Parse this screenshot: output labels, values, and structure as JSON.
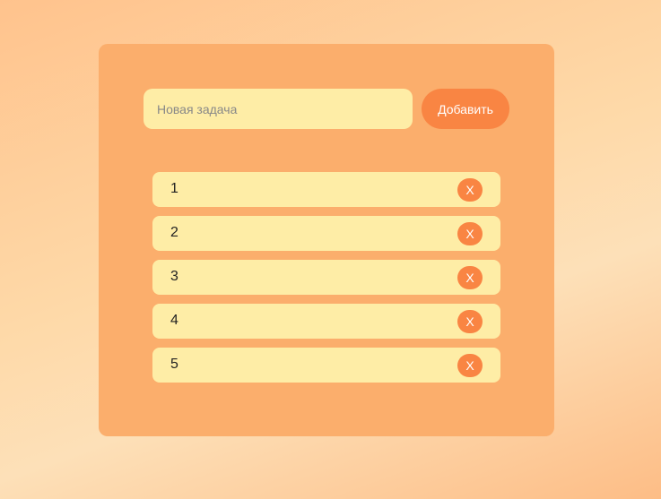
{
  "form": {
    "input_value": "",
    "input_placeholder": "Новая задача",
    "add_label": "Добавить"
  },
  "tasks": [
    {
      "text": "1",
      "delete_label": "X"
    },
    {
      "text": "2",
      "delete_label": "X"
    },
    {
      "text": "3",
      "delete_label": "X"
    },
    {
      "text": "4",
      "delete_label": "X"
    },
    {
      "text": "5",
      "delete_label": "X"
    }
  ],
  "colors": {
    "card": "#fbae6c",
    "field": "#feeda6",
    "accent": "#f98543"
  }
}
